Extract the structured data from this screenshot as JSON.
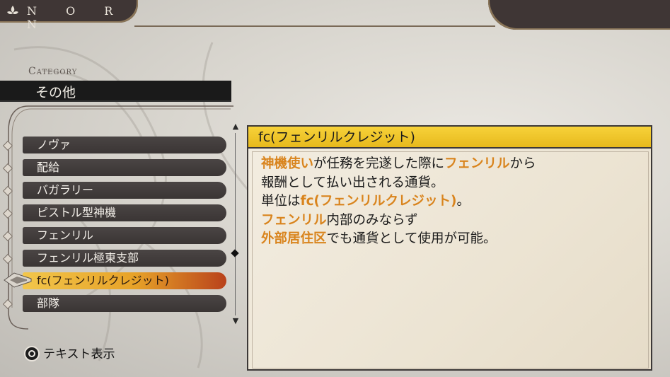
{
  "header": {
    "brand": "N O R N",
    "icon": "fleur-icon"
  },
  "category": {
    "label": "Category",
    "value": "その他"
  },
  "list": {
    "items": [
      {
        "label": "ノヴァ",
        "selected": false
      },
      {
        "label": "配給",
        "selected": false
      },
      {
        "label": "バガラリー",
        "selected": false
      },
      {
        "label": "ピストル型神機",
        "selected": false
      },
      {
        "label": "フェンリル",
        "selected": false
      },
      {
        "label": "フェンリル極東支部",
        "selected": false
      },
      {
        "label": "fc(フェンリルクレジット)",
        "selected": true
      },
      {
        "label": "部隊",
        "selected": false
      }
    ]
  },
  "detail": {
    "title": "fc(フェンリルクレジット)",
    "lines": [
      [
        {
          "t": "神機使い",
          "hl": true
        },
        {
          "t": "が任務を完遂した際に",
          "hl": false
        },
        {
          "t": "フェンリル",
          "hl": true
        },
        {
          "t": "から",
          "hl": false
        }
      ],
      [
        {
          "t": "報酬として払い出される通貨。",
          "hl": false
        }
      ],
      [
        {
          "t": "単位は",
          "hl": false
        },
        {
          "t": "fc(フェンリルクレジット)",
          "hl": true
        },
        {
          "t": "。",
          "hl": false
        }
      ],
      [
        {
          "t": "フェンリル",
          "hl": true
        },
        {
          "t": "内部のみならず",
          "hl": false
        }
      ],
      [
        {
          "t": "外部居住区",
          "hl": true
        },
        {
          "t": "でも通貨として使用が可能。",
          "hl": false
        }
      ]
    ]
  },
  "prompt": {
    "button_icon": "circle-button-icon",
    "label": "テキスト表示"
  },
  "colors": {
    "highlight": "#d9841d",
    "title_bar": "#f2c832",
    "selected_item": "#e7a228",
    "dark_bar": "#1a1a1a"
  }
}
